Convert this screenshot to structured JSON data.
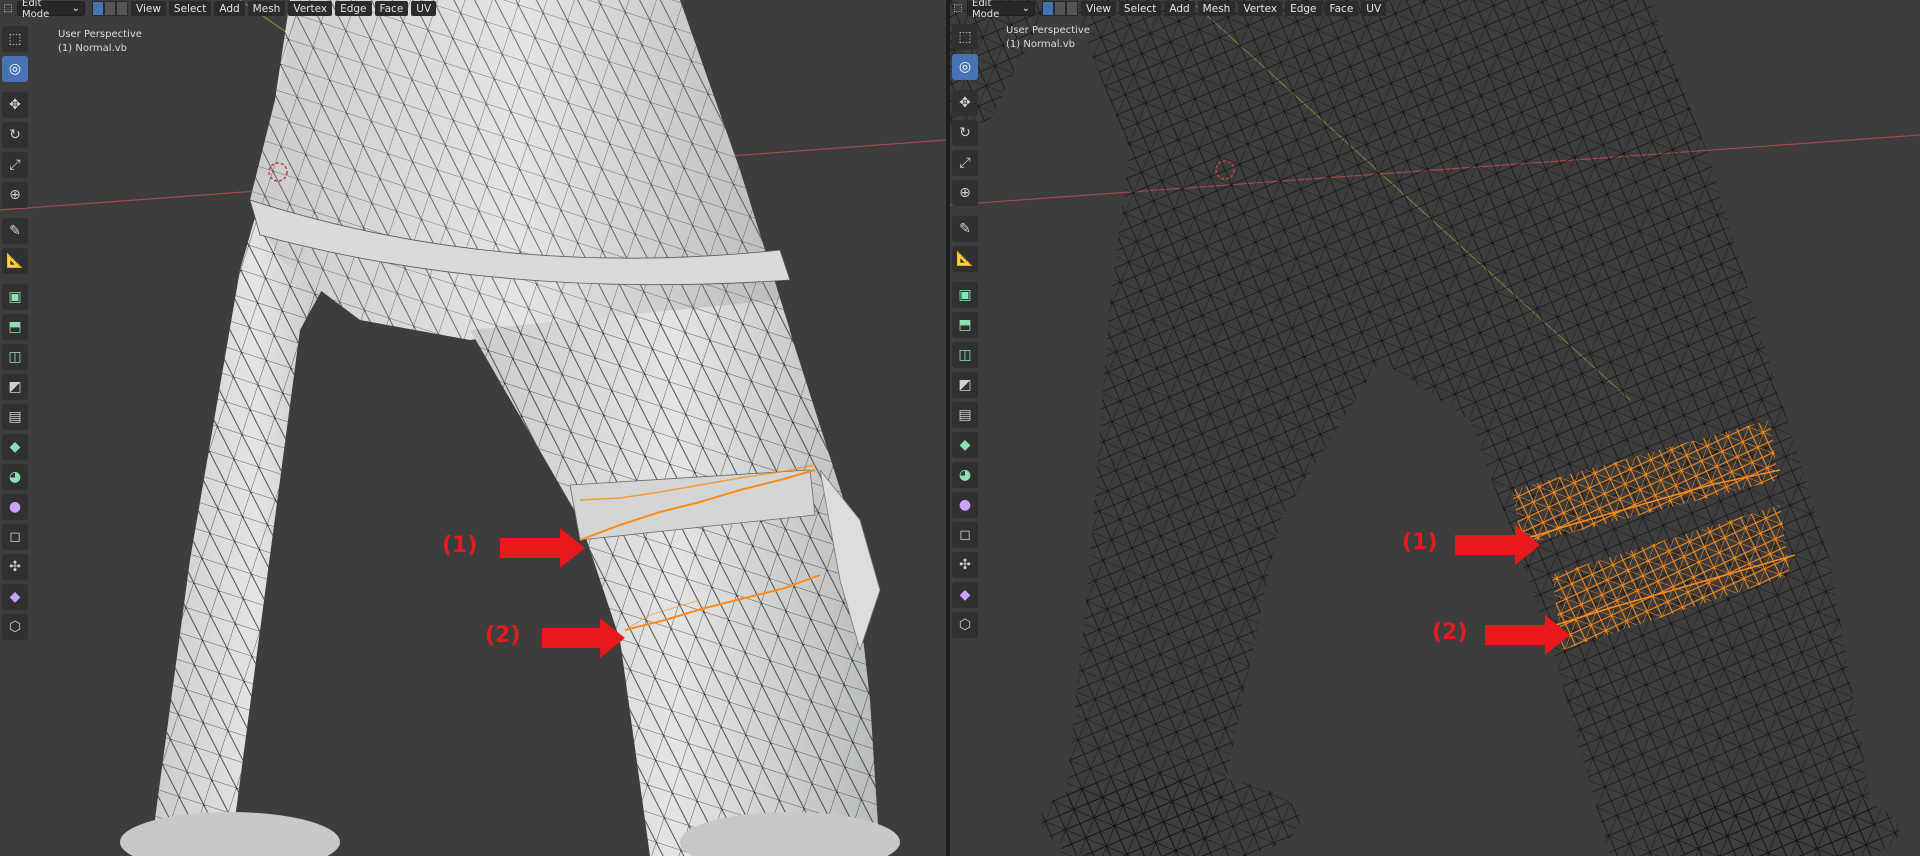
{
  "header": {
    "mode_label": "Edit Mode",
    "menus": [
      "View",
      "Select",
      "Add",
      "Mesh",
      "Vertex",
      "Edge",
      "Face",
      "UV"
    ]
  },
  "viewport_left": {
    "view_label": "User Perspective",
    "object_label": "(1) Normal.vb",
    "shading": "solid"
  },
  "viewport_right": {
    "view_label": "User Perspective",
    "object_label": "(1) Normal.vb",
    "shading": "wireframe"
  },
  "annotations": {
    "label_1": "(1)",
    "label_2": "(2)",
    "color": "#e8191c"
  },
  "tools": [
    "select-box-icon",
    "cursor-icon",
    "move-icon",
    "rotate-icon",
    "scale-icon",
    "transform-icon",
    "annotate-icon",
    "measure-icon",
    "add-cube-icon",
    "extrude-icon",
    "inset-icon",
    "bevel-icon",
    "loop-cut-icon",
    "knife-icon",
    "poly-build-icon",
    "spin-icon",
    "smooth-icon",
    "edge-slide-icon",
    "shrink-fatten-icon",
    "shear-icon",
    "rip-icon"
  ],
  "colors": {
    "background": "#3d3d3d",
    "selection": "#ff8c1a",
    "active_tool": "#4772b3",
    "x_axis": "#c0404a",
    "y_axis": "#7a9a3a"
  }
}
